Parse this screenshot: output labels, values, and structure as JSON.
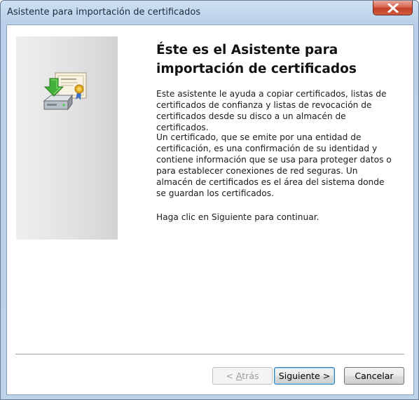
{
  "window": {
    "title": "Asistente para importación de certificados",
    "close_glyph": "×"
  },
  "wizard": {
    "heading_line1": "Éste es el Asistente para",
    "heading_line2": "importación de certificados",
    "paragraph1": "Este asistente le ayuda a copiar certificados, listas de certificados de confianza y listas de revocación de certificados desde su disco a un almacén de certificados.",
    "paragraph2": "Un certificado, que se emite por una entidad de certificación, es una confirmación de su identidad y contiene información que se usa para proteger datos o para establecer conexiones de red seguras. Un almacén de certificados es el área del sistema donde se guardan los certificados.",
    "paragraph3": "Haga clic en Siguiente para continuar.",
    "icon": "certificate-import-icon"
  },
  "buttons": {
    "back_prefix": "< ",
    "back_mnemonic": "A",
    "back_rest": "trás",
    "next_label": "Siguiente >",
    "cancel_label": "Cancelar"
  },
  "colors": {
    "title_bar": "#b9d1ea",
    "close_button": "#c23f28",
    "focus_border": "#3c7fb1"
  }
}
